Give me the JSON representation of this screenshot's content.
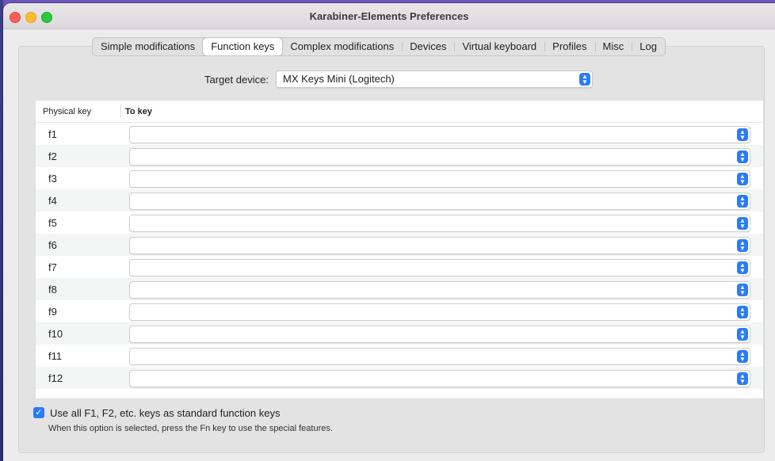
{
  "window": {
    "title": "Karabiner-Elements Preferences"
  },
  "tabs": [
    {
      "label": "Simple modifications",
      "active": false
    },
    {
      "label": "Function keys",
      "active": true
    },
    {
      "label": "Complex modifications",
      "active": false
    },
    {
      "label": "Devices",
      "active": false
    },
    {
      "label": "Virtual keyboard",
      "active": false
    },
    {
      "label": "Profiles",
      "active": false
    },
    {
      "label": "Misc",
      "active": false
    },
    {
      "label": "Log",
      "active": false
    }
  ],
  "target": {
    "label": "Target device:",
    "value": "MX Keys Mini (Logitech)"
  },
  "table": {
    "headers": {
      "physical": "Physical key",
      "to": "To key"
    },
    "rows": [
      {
        "key": "f1",
        "to": ""
      },
      {
        "key": "f2",
        "to": ""
      },
      {
        "key": "f3",
        "to": ""
      },
      {
        "key": "f4",
        "to": ""
      },
      {
        "key": "f5",
        "to": ""
      },
      {
        "key": "f6",
        "to": ""
      },
      {
        "key": "f7",
        "to": ""
      },
      {
        "key": "f8",
        "to": ""
      },
      {
        "key": "f9",
        "to": ""
      },
      {
        "key": "f10",
        "to": ""
      },
      {
        "key": "f11",
        "to": ""
      },
      {
        "key": "f12",
        "to": ""
      }
    ]
  },
  "footer": {
    "checkbox_label": "Use all F1, F2, etc. keys as standard function keys",
    "checked": true,
    "note": "When this option is selected, press the Fn key to use the special features."
  },
  "icons": {
    "stepper": "chevron-up-down-icon",
    "check": "checkmark-icon"
  },
  "colors": {
    "accent": "#2a7bf6",
    "close": "#fe5f57",
    "minimize": "#febc2e",
    "maximize": "#28c840"
  }
}
